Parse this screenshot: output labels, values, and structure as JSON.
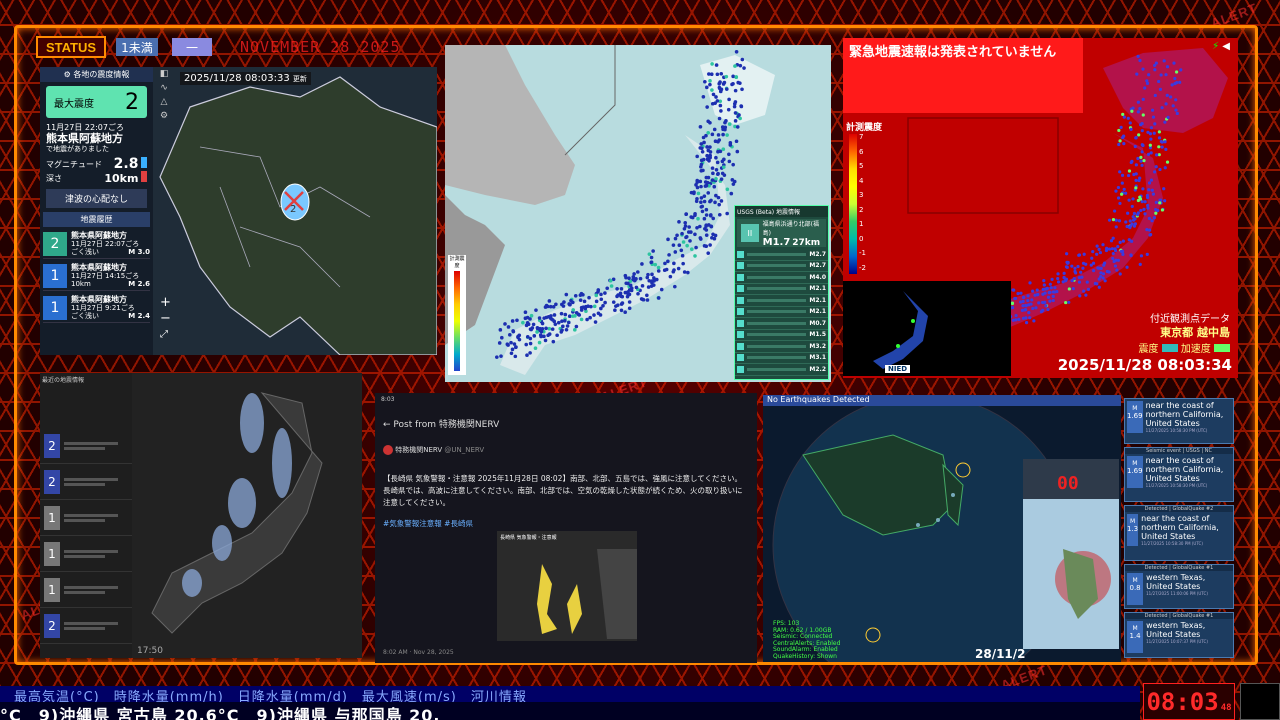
{
  "header": {
    "status_label": "STATUS",
    "chip1": "1未満",
    "chip2": "一",
    "date_bg": "NOVEMBER 28 2025",
    "alert_word": "ALERT"
  },
  "panel1": {
    "timestamp": "2025/11/28 08:03:33",
    "update_label": "更新",
    "head": "各地の震度情報",
    "max_int_label": "最大震度",
    "max_int_value": "2",
    "time": "11月27日 22:07ごろ",
    "place": "熊本県阿蘇地方",
    "note": "で地震がありました",
    "mag_label": "マグニチュード",
    "mag_value": "2.8",
    "depth_label": "深さ",
    "depth_value": "10km",
    "tsunami": "津波の心配なし",
    "history_head": "地震履歴",
    "history": [
      {
        "int": "2",
        "place": "熊本県阿蘇地方",
        "time": "11月27日 22:07ごろ",
        "depth": "ごく浅い",
        "mag": "M 3.0"
      },
      {
        "int": "1",
        "place": "熊本県阿蘇地方",
        "time": "11月27日 14:15ごろ",
        "depth": "10km",
        "mag": "M 2.6"
      },
      {
        "int": "1",
        "place": "熊本県阿蘇地方",
        "time": "11月27日 9:21ごろ",
        "depth": "ごく浅い",
        "mag": "M 2.4"
      }
    ]
  },
  "panel2": {
    "legend_title": "計測震度",
    "usgs_head": "USGS (Beta) 地震情報",
    "main_place": "福島県浜通り北部(福島)",
    "main_mag": "M1.7",
    "main_depth": "27km",
    "list": [
      "M2.7",
      "M2.7",
      "M4.0",
      "M2.1",
      "M2.1",
      "M2.1",
      "M0.7",
      "M1.5",
      "M3.2",
      "M3.1",
      "M2.2"
    ]
  },
  "panel3": {
    "title": "緊急地震速報は発表されていません",
    "scale_label": "計測震度",
    "scale_ticks": [
      "7",
      "6",
      "5",
      "4",
      "3",
      "2",
      "1",
      "0",
      "-1",
      "-2"
    ],
    "near_label": "付近観測点データ",
    "station": "東京都 越中島",
    "int_label": "震度",
    "acc_label": "加速度",
    "datetime": "2025/11/28 08:03:34",
    "nied": "NIED"
  },
  "panel4": {
    "header": "最近の地震情報",
    "time": "17:50",
    "rows": [
      "2",
      "2",
      "1",
      "1",
      "1",
      "2"
    ]
  },
  "panel5": {
    "clock": "8:03",
    "title": "Post from 特務機関NERV",
    "author": "特務機関NERV",
    "handle": "@UN_NERV",
    "body": "【長崎県 気象警報・注意報 2025年11月28日 08:02】南部、北部、五島では、強風に注意してください。長崎県では、高波に注意してください。南部、北部では、空気の乾燥した状態が続くため、火の取り扱いに注意してください。",
    "tags": "#気象警報注意報 #長崎県",
    "map_title": "長崎県 気象警報・注意報",
    "footer": "8:02 AM · Nov 28, 2025"
  },
  "panel6": {
    "banner": "No Earthquakes Detected",
    "counter": "00",
    "date": "28/11/2",
    "stats": [
      "FPS: 103",
      "RAM: 0.62 / 1.00GB",
      "Seismic: Connected",
      "CentralAlerts: Enabled",
      "SoundAlarm: Enabled",
      "QuakeHistory: Shown"
    ]
  },
  "usgs_cards": [
    {
      "head": "",
      "mag": "1.69",
      "place": "near the coast of northern California, United States",
      "meta": "11/27/2025 10:58:30 PM (UTC)"
    },
    {
      "head": "Seismic event | USGS | NC",
      "mag": "1.69",
      "place": "near the coast of northern California, United States",
      "meta": "11/27/2025 10:58:30 PM (UTC)"
    },
    {
      "head": "Detected | GlobalQuake #2",
      "mag": "1.3",
      "place": "near the coast of northern California, United States",
      "meta": "11/27/2025 10:58:30 PM (UTC)"
    },
    {
      "head": "Detected | GlobalQuake #1",
      "mag": "0.8",
      "place": "western Texas, United States",
      "meta": "11/27/2025 11:00:06 PM (UTC)"
    },
    {
      "head": "Detected | GlobalQuake #1",
      "mag": "1.4",
      "place": "western Texas, United States",
      "meta": "11/27/2025 10:07:37 PM (UTC)"
    }
  ],
  "ticker": {
    "top": "最高気温(°C)　時降水量(mm/h)　日降水量(mm/d)　最大風速(m/s)　河川情報",
    "bottom": "°C　9)沖縄県 宮古島 20.6°C　9)沖縄県 与那国島 20."
  },
  "clock": {
    "time": "08:03",
    "sec": "48"
  }
}
